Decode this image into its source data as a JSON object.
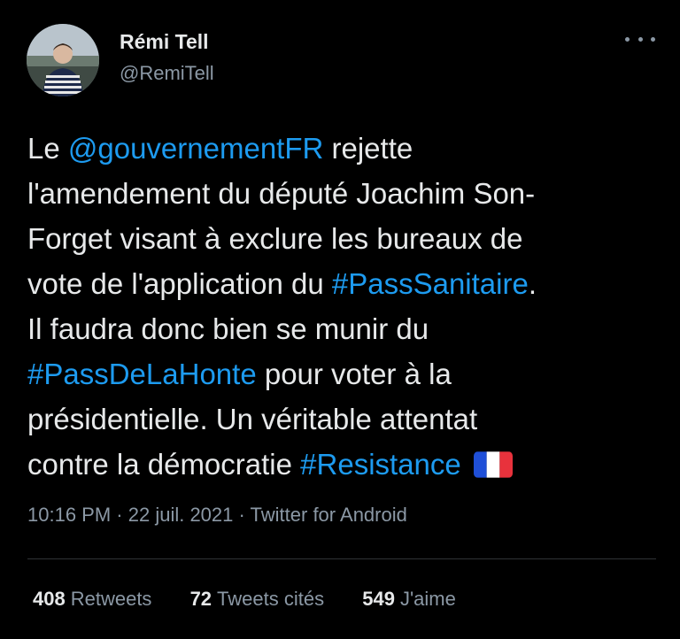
{
  "user": {
    "name": "Rémi Tell",
    "handle": "@RemiTell"
  },
  "tweet": {
    "lines": [
      [
        {
          "t": "Le "
        },
        {
          "t": "@gouvernementFR",
          "link": true
        },
        {
          "t": " rejette"
        }
      ],
      [
        {
          "t": "l'amendement du député Joachim Son-"
        }
      ],
      [
        {
          "t": "Forget visant à exclure les bureaux de"
        }
      ],
      [
        {
          "t": "vote de l'application du "
        },
        {
          "t": "#PassSanitaire",
          "link": true
        },
        {
          "t": "."
        }
      ],
      [
        {
          "t": "Il faudra donc bien se munir du"
        }
      ],
      [
        {
          "t": "#PassDeLaHonte",
          "link": true
        },
        {
          "t": " pour voter à la"
        }
      ],
      [
        {
          "t": "présidentielle. Un véritable attentat"
        }
      ],
      [
        {
          "t": "contre la démocratie "
        },
        {
          "t": "#Resistance",
          "link": true
        },
        {
          "flag": "france-flag-icon"
        }
      ]
    ]
  },
  "meta": {
    "time": "10:16 PM",
    "sep1": " · ",
    "date": "22 juil. 2021",
    "sep2": " · ",
    "source": "Twitter for Android"
  },
  "stats": {
    "retweets_count": "408",
    "retweets_label": "Retweets",
    "quotes_count": "72",
    "quotes_label": "Tweets cités",
    "likes_count": "549",
    "likes_label": "J'aime"
  },
  "colors": {
    "background": "#000000",
    "text": "#e7e9ea",
    "secondary": "#8b98a5",
    "link": "#1d9bf0",
    "divider": "#2f3336"
  },
  "icons": {
    "more": "more-dots-icon",
    "flag": "france-flag-icon"
  }
}
